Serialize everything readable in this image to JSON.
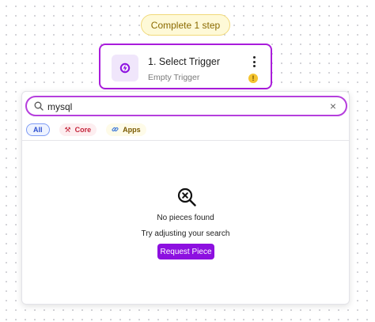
{
  "header": {
    "step_pill_label": "Complete 1 step"
  },
  "trigger": {
    "title": "1. Select Trigger",
    "subtitle": "Empty Trigger",
    "icon": "trigger-bolt-icon",
    "status_icon": "warning-icon"
  },
  "search": {
    "value": "mysql",
    "placeholder": ""
  },
  "filters": [
    {
      "label": "All",
      "selected": true
    },
    {
      "label": "Core",
      "icon": "tools-icon"
    },
    {
      "label": "Apps",
      "icon": "link-icon"
    }
  ],
  "empty_state": {
    "title": "No pieces found",
    "subtitle": "Try adjusting your search",
    "button_label": "Request Piece",
    "icon": "search-x-icon"
  },
  "colors": {
    "accent": "#8d10e0",
    "search_border": "#b53fdd",
    "card_border": "#a91cdb",
    "pill_bg": "#fef9d7",
    "warning": "#f4c430"
  }
}
